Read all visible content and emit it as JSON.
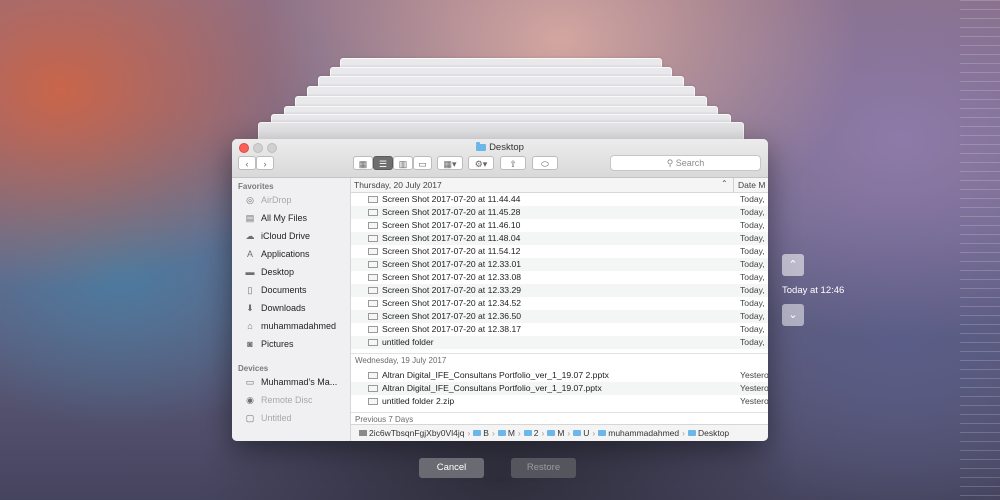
{
  "window": {
    "title": "Desktop",
    "search_placeholder": "Search",
    "icons": {
      "back": "chevron-left-icon",
      "forward": "chevron-right-icon",
      "view_icon": "grid-icon",
      "view_list": "list-icon",
      "view_column": "columns-icon",
      "view_coverflow": "coverflow-icon",
      "group": "group-icon",
      "action": "gear-icon",
      "share": "share-icon",
      "tag": "tag-icon"
    }
  },
  "sidebar": {
    "favorites_header": "Favorites",
    "favorites": [
      {
        "label": "AirDrop",
        "icon": "airdrop-icon",
        "dim": true
      },
      {
        "label": "All My Files",
        "icon": "files-icon",
        "dim": false
      },
      {
        "label": "iCloud Drive",
        "icon": "cloud-icon",
        "dim": false
      },
      {
        "label": "Applications",
        "icon": "applications-icon",
        "dim": false
      },
      {
        "label": "Desktop",
        "icon": "desktop-icon",
        "dim": false
      },
      {
        "label": "Documents",
        "icon": "documents-icon",
        "dim": false
      },
      {
        "label": "Downloads",
        "icon": "downloads-icon",
        "dim": false
      },
      {
        "label": "muhammadahmed",
        "icon": "home-icon",
        "dim": false
      },
      {
        "label": "Pictures",
        "icon": "camera-icon",
        "dim": false
      }
    ],
    "devices_header": "Devices",
    "devices": [
      {
        "label": "Muhammad's Ma...",
        "icon": "laptop-icon",
        "dim": false
      },
      {
        "label": "Remote Disc",
        "icon": "disc-icon",
        "dim": true
      },
      {
        "label": "Untitled",
        "icon": "drive-icon",
        "dim": true
      }
    ]
  },
  "columns": {
    "name_header": "Thursday, 20 July 2017",
    "date_header": "Date M"
  },
  "groups": [
    {
      "header": "Thursday, 20 July 2017",
      "rows": [
        {
          "name": "Screen Shot 2017-07-20 at 11.44.44",
          "date": "Today,"
        },
        {
          "name": "Screen Shot 2017-07-20 at 11.45.28",
          "date": "Today,"
        },
        {
          "name": "Screen Shot 2017-07-20 at 11.46.10",
          "date": "Today,"
        },
        {
          "name": "Screen Shot 2017-07-20 at 11.48.04",
          "date": "Today,"
        },
        {
          "name": "Screen Shot 2017-07-20 at 11.54.12",
          "date": "Today,"
        },
        {
          "name": "Screen Shot 2017-07-20 at 12.33.01",
          "date": "Today,"
        },
        {
          "name": "Screen Shot 2017-07-20 at 12.33.08",
          "date": "Today,"
        },
        {
          "name": "Screen Shot 2017-07-20 at 12.33.29",
          "date": "Today,"
        },
        {
          "name": "Screen Shot 2017-07-20 at 12.34.52",
          "date": "Today,"
        },
        {
          "name": "Screen Shot 2017-07-20 at 12.36.50",
          "date": "Today,"
        },
        {
          "name": "Screen Shot 2017-07-20 at 12.38.17",
          "date": "Today,"
        },
        {
          "name": "untitled folder",
          "date": "Today,"
        }
      ]
    },
    {
      "header": "Wednesday, 19 July 2017",
      "rows": [
        {
          "name": "Altran Digital_IFE_Consultans Portfolio_ver_1_19.07 2.pptx",
          "date": "Yestero"
        },
        {
          "name": "Altran Digital_IFE_Consultans Portfolio_ver_1_19.07.pptx",
          "date": "Yestero"
        },
        {
          "name": "untitled folder 2.zip",
          "date": "Yestero"
        }
      ]
    },
    {
      "header": "Previous 7 Days",
      "rows": []
    }
  ],
  "path_bar": [
    "2ic6wTbsqnFgjXby0Vl4jq",
    "B",
    "M",
    "2",
    "M",
    "U",
    "muhammadahmed",
    "Desktop"
  ],
  "time_machine": {
    "label": "Today at 12:46",
    "up_icon": "chevron-up-icon",
    "down_icon": "chevron-down-icon"
  },
  "buttons": {
    "cancel": "Cancel",
    "restore": "Restore"
  },
  "colors": {
    "accent_folder": "#6cb6ea",
    "close": "#fc5f57",
    "button_active": "#6a6a72",
    "button_disabled": "#55555e"
  }
}
